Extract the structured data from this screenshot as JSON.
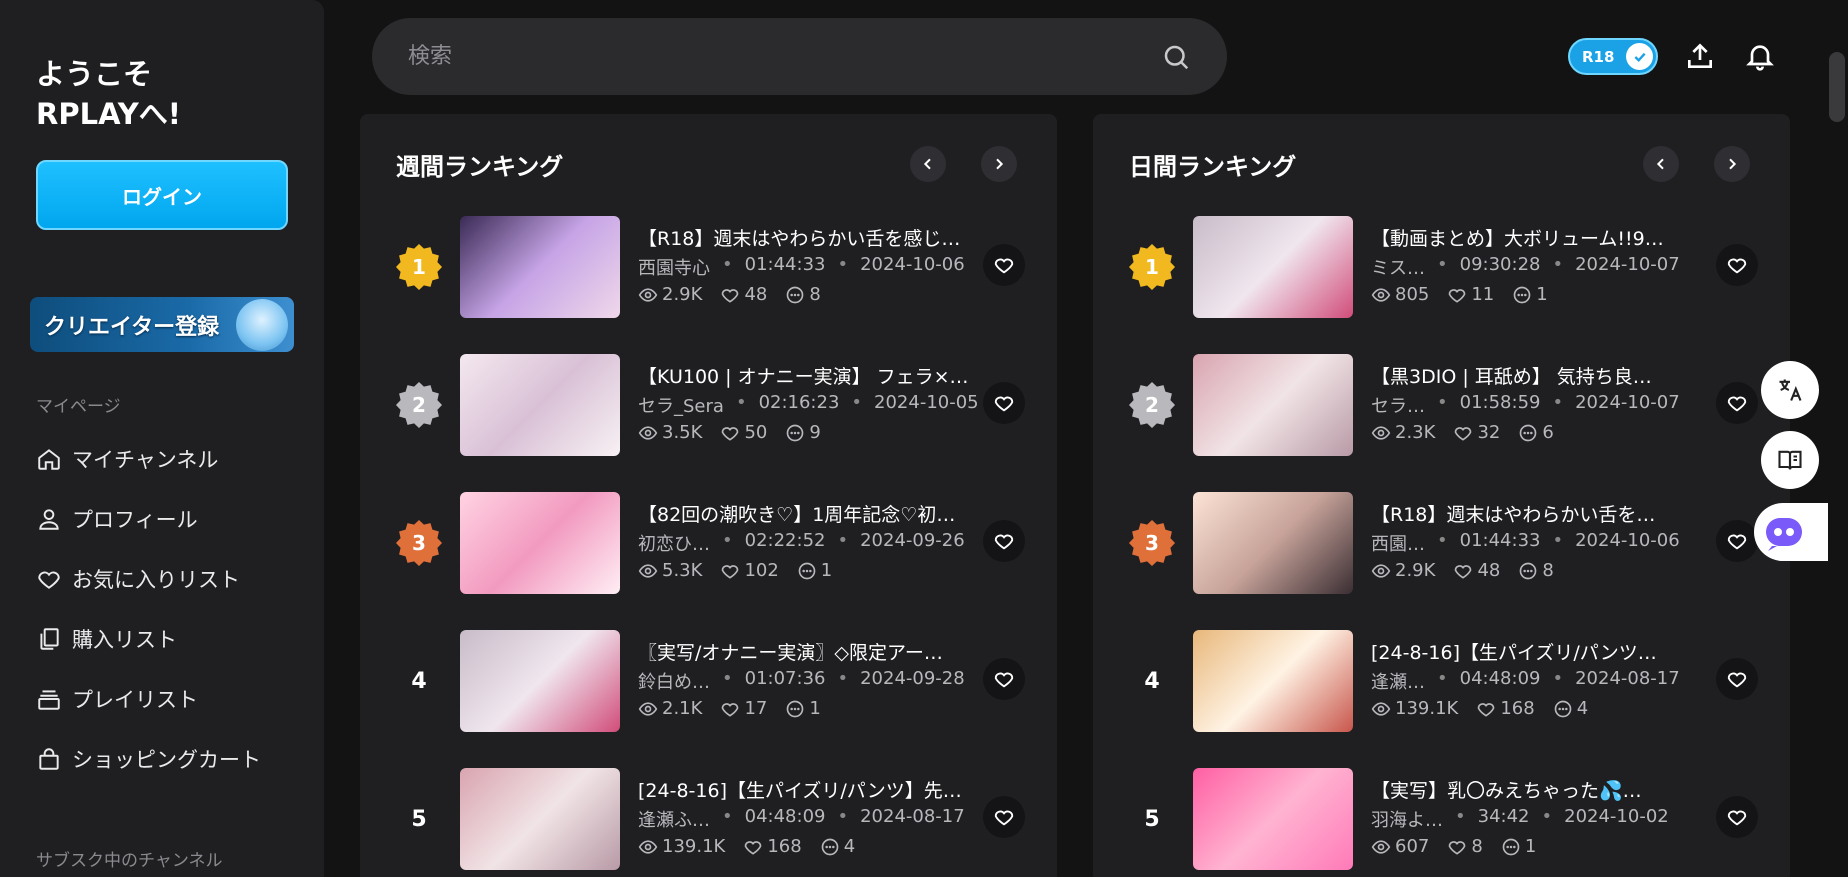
{
  "sidebar": {
    "welcome_line1": "ようこそ",
    "welcome_line2": "RPLAYへ!",
    "login_label": "ログイン",
    "creator_banner_label": "クリエイター登録",
    "mypage_label": "マイページ",
    "items": [
      {
        "label": "マイチャンネル",
        "icon": "home-icon"
      },
      {
        "label": "プロフィール",
        "icon": "user-icon"
      },
      {
        "label": "お気に入りリスト",
        "icon": "heart-icon"
      },
      {
        "label": "購入リスト",
        "icon": "copy-icon"
      },
      {
        "label": "プレイリスト",
        "icon": "playlist-icon"
      },
      {
        "label": "ショッピングカート",
        "icon": "bag-icon"
      }
    ],
    "subscribed_label": "サブスク中のチャンネル"
  },
  "topbar": {
    "search_placeholder": "検索",
    "r18_label": "R18",
    "r18_enabled": true
  },
  "weekly": {
    "title": "週間ランキング",
    "rows": [
      {
        "rank": "1",
        "title": "【R18】週末はやわらかい舌を感じ…",
        "author": "西園寺心",
        "duration": "01:44:33",
        "date": "2024-10-06",
        "views": "2.9K",
        "likes": "48",
        "comments": "8"
      },
      {
        "rank": "2",
        "title": "【KU100 | オナニー実演】 フェラ×…",
        "author": "セラ_Sera",
        "duration": "02:16:23",
        "date": "2024-10-05",
        "views": "3.5K",
        "likes": "50",
        "comments": "9"
      },
      {
        "rank": "3",
        "title": "【82回の潮吹き♡】1周年記念♡初…",
        "author": "初恋ひ…",
        "duration": "02:22:52",
        "date": "2024-09-26",
        "views": "5.3K",
        "likes": "102",
        "comments": "1"
      },
      {
        "rank": "4",
        "title": "〖実写/オナニー実演〗◇限定アー…",
        "author": "鈴白め…",
        "duration": "01:07:36",
        "date": "2024-09-28",
        "views": "2.1K",
        "likes": "17",
        "comments": "1"
      },
      {
        "rank": "5",
        "title": "[24-8-16]【生パイズリ/パンツ】先…",
        "author": "逢瀬ふ…",
        "duration": "04:48:09",
        "date": "2024-08-17",
        "views": "139.1K",
        "likes": "168",
        "comments": "4"
      }
    ]
  },
  "daily": {
    "title": "日間ランキング",
    "rows": [
      {
        "rank": "1",
        "title": "【動画まとめ】大ボリューム!!9…",
        "author": "ミス…",
        "duration": "09:30:28",
        "date": "2024-10-07",
        "views": "805",
        "likes": "11",
        "comments": "1"
      },
      {
        "rank": "2",
        "title": "【黒3DIO | 耳舐め】 気持ち良…",
        "author": "セラ…",
        "duration": "01:58:59",
        "date": "2024-10-07",
        "views": "2.3K",
        "likes": "32",
        "comments": "6"
      },
      {
        "rank": "3",
        "title": "【R18】週末はやわらかい舌を…",
        "author": "西園…",
        "duration": "01:44:33",
        "date": "2024-10-06",
        "views": "2.9K",
        "likes": "48",
        "comments": "8"
      },
      {
        "rank": "4",
        "title": "[24-8-16]【生パイズリ/パンツ…",
        "author": "逢瀬…",
        "duration": "04:48:09",
        "date": "2024-08-17",
        "views": "139.1K",
        "likes": "168",
        "comments": "4"
      },
      {
        "rank": "5",
        "title": "【実写】乳〇みえちゃった💦…",
        "author": "羽海よ…",
        "duration": "34:42",
        "date": "2024-10-02",
        "views": "607",
        "likes": "8",
        "comments": "1"
      }
    ]
  },
  "colors": {
    "accent": "#1ba2e6",
    "gold": "#f2b81f",
    "silver": "#b9b9bd",
    "bronze": "#e0703a"
  }
}
